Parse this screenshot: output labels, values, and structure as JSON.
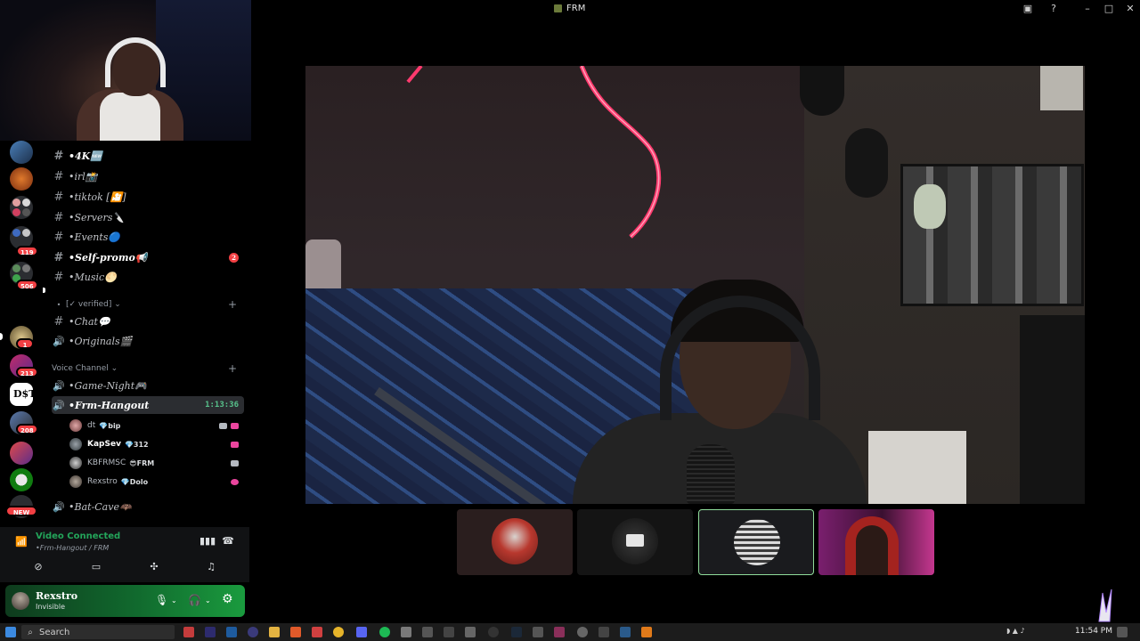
{
  "window": {
    "title": "FRM"
  },
  "server_rail": {
    "badges": [
      "119",
      "506",
      "1",
      "213",
      "208",
      "NEW"
    ]
  },
  "channels": [
    {
      "type": "text",
      "label": "•4K🆕",
      "bold": true,
      "unread": true
    },
    {
      "type": "text",
      "label": "•irl📸"
    },
    {
      "type": "text",
      "label": "•tiktok [🎦]"
    },
    {
      "type": "text",
      "label": "•Servers🔪"
    },
    {
      "type": "text",
      "label": "•Events🔵"
    },
    {
      "type": "text",
      "label": "•Self-promo📢",
      "bold": true,
      "unread": true,
      "mentions": "2"
    },
    {
      "type": "text",
      "label": "•Music🌕"
    }
  ],
  "category_verified": {
    "label": "[✓ verified] ⌄"
  },
  "channels2": [
    {
      "type": "text",
      "label": "•Chat💬"
    },
    {
      "type": "voice",
      "label": "•Originals🎬"
    }
  ],
  "category_voice": {
    "label": "Voice Channel ⌄"
  },
  "voice_channels": {
    "game_night": "•Game-Night🎮",
    "hangout": "•Frm-Hangout",
    "hangout_timer": "1:13:36",
    "bat_cave": "•Bat-Cave🦇"
  },
  "voice_users": [
    {
      "name": "dt",
      "tag": "💎bip"
    },
    {
      "name": "KapSev",
      "tag": "💎312"
    },
    {
      "name": "KBFRMSC",
      "tag": "😎FRM"
    },
    {
      "name": "Rexstro",
      "tag": "💎Dolo"
    }
  ],
  "voice_panel": {
    "status": "Video Connected",
    "channel": "•Frm-Hangout / FRM"
  },
  "user_panel": {
    "name": "Rexstro",
    "status": "Invisible"
  },
  "taskbar": {
    "search_placeholder": "Search",
    "time": "11:54 PM"
  },
  "colors": {
    "connected_green": "#23a55a",
    "mention_red": "#f23f43",
    "selected_border": "#8fdc9a"
  }
}
